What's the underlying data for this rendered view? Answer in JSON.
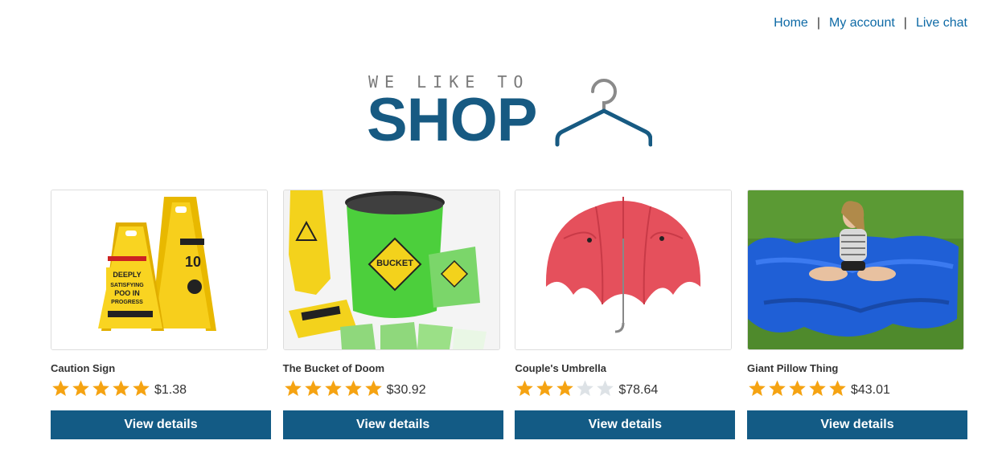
{
  "nav": {
    "home": "Home",
    "account": "My account",
    "chat": "Live chat",
    "separator": "|"
  },
  "logo": {
    "tagline": "WE LIKE TO",
    "word": "SHOP"
  },
  "colors": {
    "brand": "#175a82",
    "button": "#135b85",
    "link": "#0e6aa6",
    "star": "#f5a312",
    "star_empty": "#dde2e6"
  },
  "products": [
    {
      "name": "Caution Sign",
      "rating": 5,
      "price": "$1.38",
      "button": "View details",
      "image_icon": "caution-sign-image"
    },
    {
      "name": "The Bucket of Doom",
      "rating": 5,
      "price": "$30.92",
      "button": "View details",
      "image_icon": "bucket-image"
    },
    {
      "name": "Couple's Umbrella",
      "rating": 3,
      "price": "$78.64",
      "button": "View details",
      "image_icon": "umbrella-image"
    },
    {
      "name": "Giant Pillow Thing",
      "rating": 5,
      "price": "$43.01",
      "button": "View details",
      "image_icon": "pillow-image"
    }
  ]
}
